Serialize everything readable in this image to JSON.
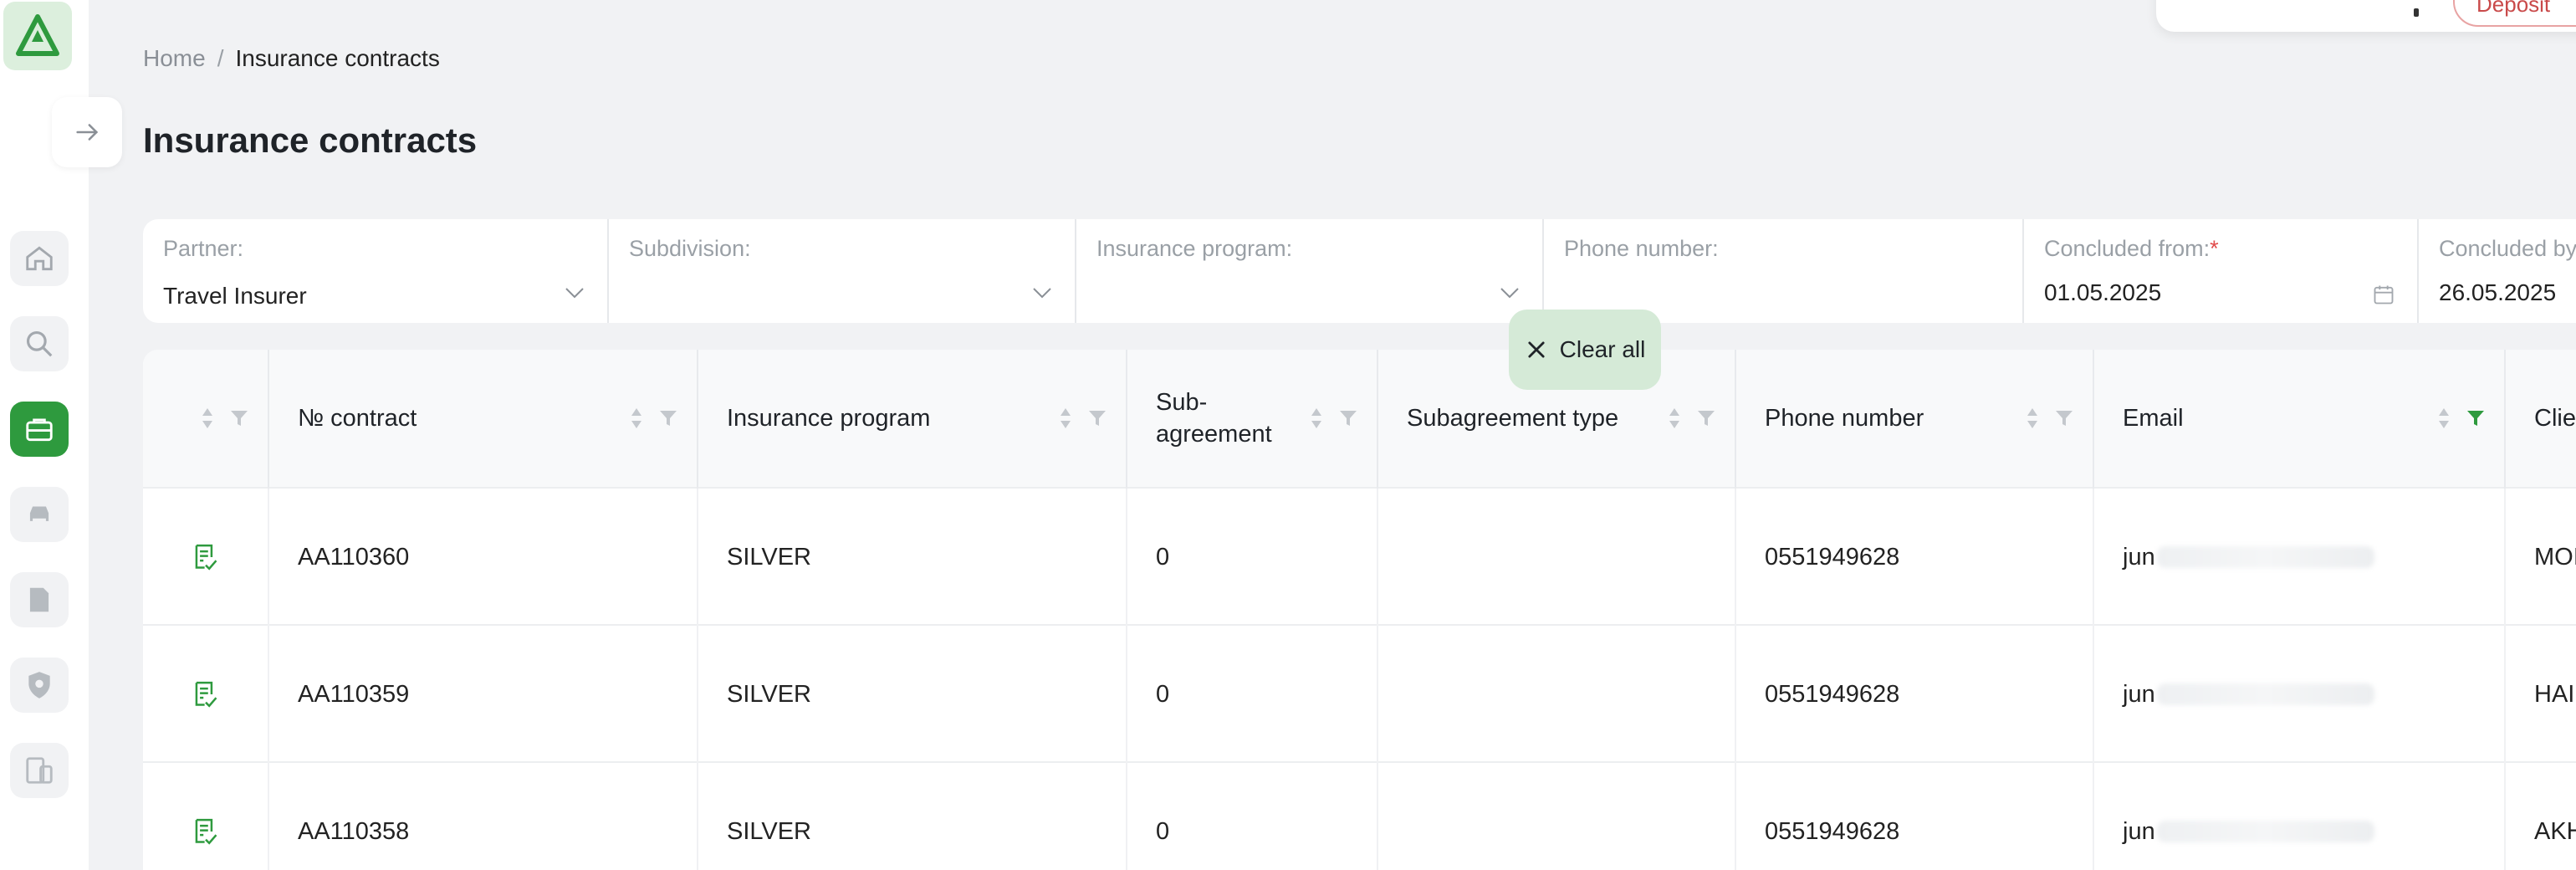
{
  "breadcrumb": {
    "home": "Home",
    "separator": "/",
    "current": "Insurance contracts"
  },
  "page": {
    "title": "Insurance contracts"
  },
  "topright": {
    "button_label": "Deposit"
  },
  "filters": {
    "partner": {
      "label": "Partner:",
      "value": "Travel Insurer"
    },
    "subdivision": {
      "label": "Subdivision:",
      "value": ""
    },
    "program": {
      "label": "Insurance program:",
      "value": ""
    },
    "phone": {
      "label": "Phone number:",
      "value": ""
    },
    "concluded_from": {
      "label": "Concluded from:",
      "required_mark": "*",
      "value": "01.05.2025"
    },
    "concluded_by": {
      "label": "Concluded by",
      "value": "26.05.2025"
    }
  },
  "clear_all": {
    "label": "Clear all"
  },
  "table": {
    "columns": {
      "contract": "№ contract",
      "program": "Insurance program",
      "subagreement": "Sub-agreement",
      "subagreement_type": "Subagreement type",
      "phone": "Phone number",
      "email": "Email",
      "client": "Client"
    },
    "rows": [
      {
        "contract": "AA110360",
        "program": "SILVER",
        "subagreement": "0",
        "subagreement_type": "",
        "phone": "0551949628",
        "email": "jun",
        "client": "MOI"
      },
      {
        "contract": "AA110359",
        "program": "SILVER",
        "subagreement": "0",
        "subagreement_type": "",
        "phone": "0551949628",
        "email": "jun",
        "client": "HAI"
      },
      {
        "contract": "AA110358",
        "program": "SILVER",
        "subagreement": "0",
        "subagreement_type": "",
        "phone": "0551949628",
        "email": "jun",
        "client": "AKH"
      }
    ]
  },
  "colors": {
    "accent": "#2e9a3e",
    "accent_light": "#dcefdd",
    "background": "#f1f2f4",
    "required": "#e14b4b"
  }
}
